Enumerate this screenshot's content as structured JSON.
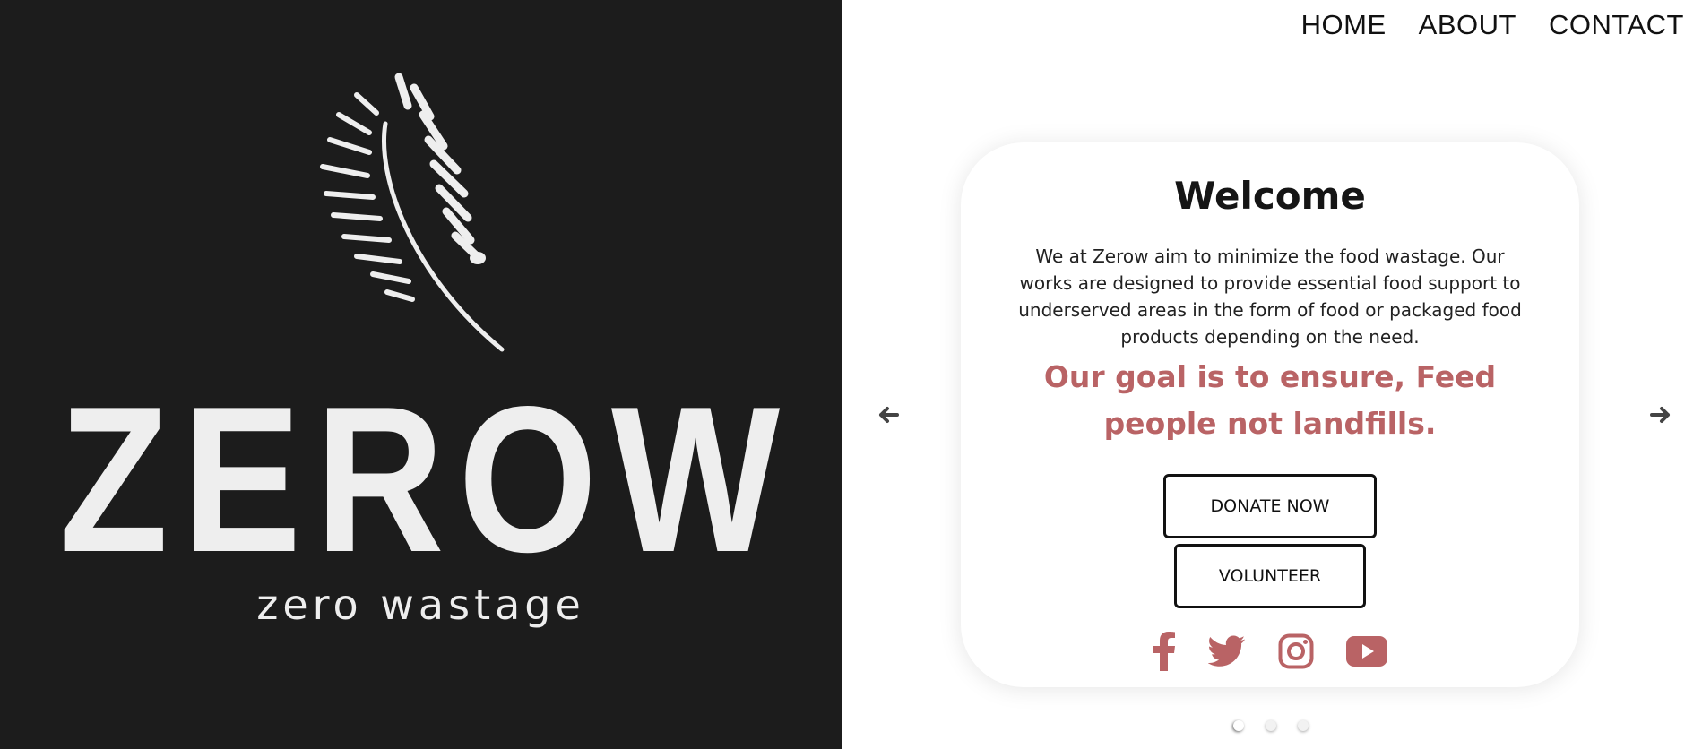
{
  "hero": {
    "brand": "ZEROW",
    "tagline": "zero wastage",
    "logo_icon": "leaf-icon"
  },
  "nav": {
    "items": [
      {
        "label": "HOME"
      },
      {
        "label": "ABOUT"
      },
      {
        "label": "CONTACT"
      }
    ]
  },
  "card": {
    "title": "Welcome",
    "text": "We at Zerow aim to minimize the food wastage. Our works are designed to provide essential food support to underserved areas in the form of food or packaged food products depending on the need.",
    "goal": "Our goal is to ensure, Feed people not landfills.",
    "donate_label": "DONATE NOW",
    "volunteer_label": "VOLUNTEER",
    "socials": [
      "facebook-icon",
      "twitter-icon",
      "instagram-icon",
      "youtube-icon"
    ]
  },
  "carousel": {
    "prev_icon": "arrow-left-icon",
    "next_icon": "arrow-right-icon",
    "slide_count": 3,
    "active_slide": 1
  },
  "colors": {
    "hero_bg": "#1c1c1c",
    "accent": "#b96365",
    "text": "#151515"
  }
}
